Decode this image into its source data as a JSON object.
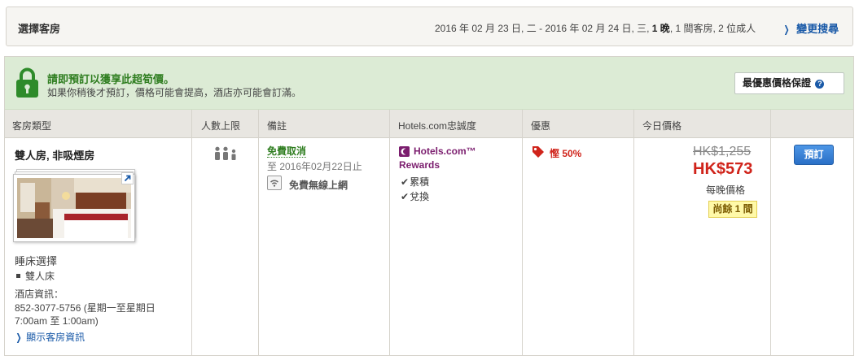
{
  "search_bar": {
    "title": "選擇客房",
    "dates_prefix": "2016 年 02 月 23 日, 二 - 2016 年 02 月 24 日, 三, ",
    "nights": "1 晚",
    "dates_suffix": ", 1 間客房, 2 位成人",
    "change_label": "變更搜尋"
  },
  "promo": {
    "headline": "請即預訂以獲享此超筍價。",
    "subtext": "如果你稍後才預訂，價格可能會提高，酒店亦可能會訂滿。",
    "guarantee_label": "最優惠價格保證"
  },
  "table_headers": [
    "客房類型",
    "人數上限",
    "備註",
    "Hotels.com忠誠度",
    "優惠",
    "今日價格"
  ],
  "room": {
    "name": "雙人房, 非吸煙房",
    "bed_choice_label": "睡床選擇",
    "bed_type": "雙人床",
    "hotel_info_label": "酒店資訊：",
    "hotel_info_line1": "852-3077-5756 (星期一至星期日",
    "hotel_info_line2": "7:00am 至 1:00am)",
    "show_room_info": "顯示客房資訊",
    "free_cancel": "免費取消",
    "cancel_until": "至 2016年02月22日止",
    "wifi": "免費無線上網",
    "rewards_line1": "Hotels.com™",
    "rewards_line2": "Rewards",
    "earn": "累積",
    "redeem": "兌換",
    "saving": "慳 50%",
    "old_price": "HK$1,255",
    "new_price": "HK$573",
    "per_night": "每晚價格",
    "rooms_left": "尚餘 1 間",
    "book_label": "預訂"
  },
  "colors": {
    "accent_blue": "#1a5aa8",
    "promo_green": "#2e7d1f",
    "price_red": "#d0241b",
    "rewards_purple": "#7b1d6e"
  }
}
